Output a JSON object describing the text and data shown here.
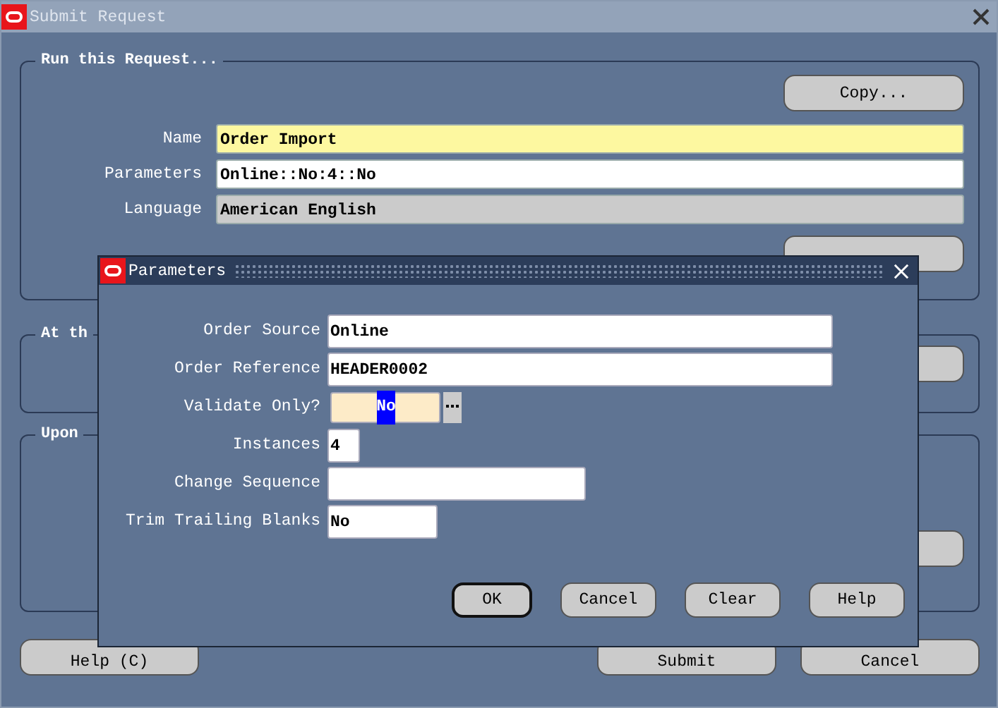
{
  "window": {
    "title": "Submit Request"
  },
  "run_request": {
    "title": "Run this Request...",
    "copy_button": "Copy...",
    "fields": [
      {
        "label": "Name",
        "value": "Order Import",
        "kind": "required"
      },
      {
        "label": "Parameters",
        "value": "Online::No:4::No",
        "kind": "normal"
      },
      {
        "label": "Language",
        "value": "American English",
        "kind": "readonly"
      }
    ]
  },
  "schedule_group": {
    "title": "At th"
  },
  "completion_group": {
    "title": "Upon"
  },
  "buttons": [
    {
      "label": "Help (C)"
    },
    {
      "label": "Submit"
    },
    {
      "label": "Cancel"
    }
  ],
  "dialog": {
    "title": "Parameters",
    "fields": [
      {
        "label": "Order Source",
        "value": "Online",
        "kind": "text"
      },
      {
        "label": "Order Reference",
        "value": "HEADER0002",
        "kind": "text"
      },
      {
        "label": "Validate Only?",
        "value": "No",
        "kind": "lov",
        "text_selected": true
      },
      {
        "label": "Instances",
        "value": "4",
        "kind": "text"
      },
      {
        "label": "Change Sequence",
        "kind": "text"
      },
      {
        "label": "Trim Trailing Blanks",
        "value": "No",
        "kind": "text"
      }
    ],
    "buttons": [
      {
        "label": "OK",
        "default": true
      },
      {
        "label": "Cancel",
        "default": false
      },
      {
        "label": "Clear",
        "default": false
      },
      {
        "label": "Help",
        "default": false
      }
    ]
  }
}
